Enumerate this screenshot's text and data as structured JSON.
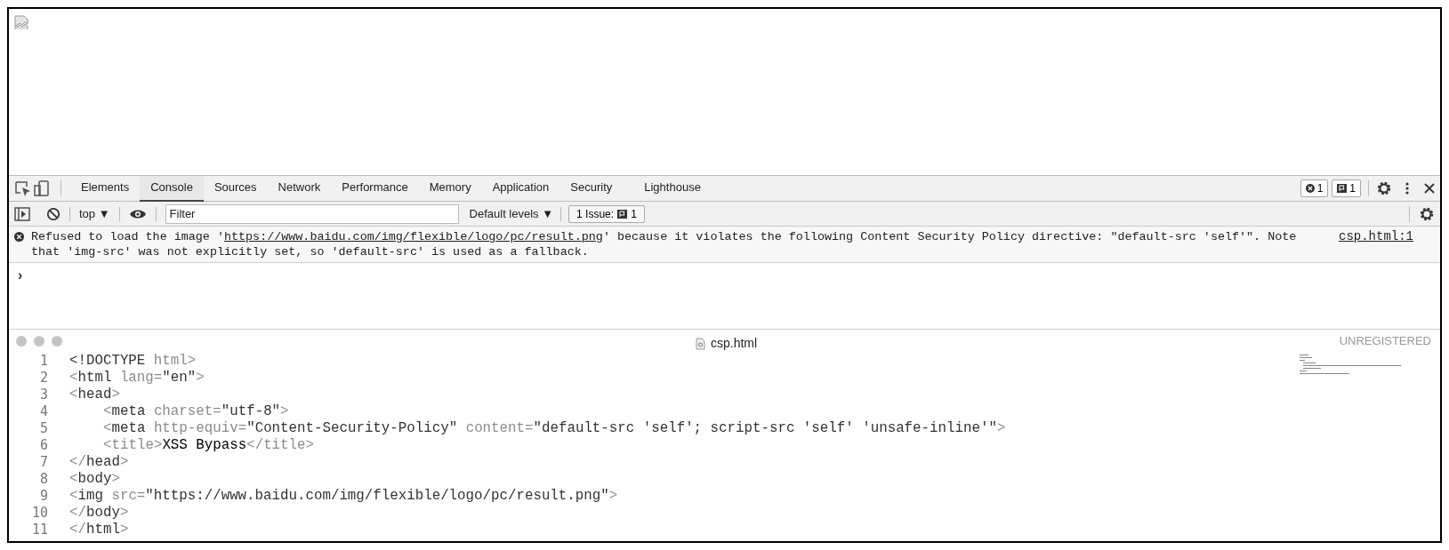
{
  "page": {
    "broken_image": true
  },
  "devtools": {
    "tabs": [
      {
        "label": "Elements",
        "selected": false
      },
      {
        "label": "Console",
        "selected": true
      },
      {
        "label": "Sources",
        "selected": false
      },
      {
        "label": "Network",
        "selected": false
      },
      {
        "label": "Performance",
        "selected": false
      },
      {
        "label": "Memory",
        "selected": false
      },
      {
        "label": "Application",
        "selected": false
      },
      {
        "label": "Security",
        "selected": false
      },
      {
        "label": "Lighthouse",
        "selected": false
      }
    ],
    "error_count": "1",
    "issue_count": "1",
    "context": "top ▼",
    "filter": {
      "placeholder": "Filter"
    },
    "levels": "Default levels ▼",
    "issues": {
      "label": "1 Issue:",
      "count": "1"
    },
    "message": {
      "before": "Refused to load the image '",
      "url": "https://www.baidu.com/img/flexible/logo/pc/result.png",
      "after_line1": "' because it violates the following Content Security Policy directive: \"default-src 'self'\". Note",
      "line2": "that 'img-src' was not explicitly set, so 'default-src' is used as a fallback.",
      "source": "csp.html:1"
    },
    "prompt": "›"
  },
  "editor": {
    "file": "csp.html",
    "badge": "UNREGISTERED",
    "lines": [
      {
        "number": "1",
        "tokens": [
          {
            "kind": "tag",
            "text": "<!DOCTYPE"
          },
          {
            "kind": "attr",
            "text": " html"
          },
          {
            "kind": "punct",
            "text": ">"
          }
        ]
      },
      {
        "number": "2",
        "tokens": [
          {
            "kind": "punct",
            "text": "<"
          },
          {
            "kind": "tag",
            "text": "html"
          },
          {
            "kind": "attr",
            "text": " lang"
          },
          {
            "kind": "punct",
            "text": "="
          },
          {
            "kind": "value",
            "text": "\"en\""
          },
          {
            "kind": "punct",
            "text": ">"
          }
        ]
      },
      {
        "number": "3",
        "tokens": [
          {
            "kind": "punct",
            "text": "<"
          },
          {
            "kind": "tag",
            "text": "head"
          },
          {
            "kind": "punct",
            "text": ">"
          }
        ],
        "children": [
          {
            "number": "4",
            "tokens": [
              {
                "kind": "punct",
                "text": "<"
              },
              {
                "kind": "tag",
                "text": "meta"
              },
              {
                "kind": "attr",
                "text": " charset"
              },
              {
                "kind": "punct",
                "text": "="
              },
              {
                "kind": "value",
                "text": "\"utf-8\""
              },
              {
                "kind": "punct",
                "text": ">"
              }
            ]
          },
          {
            "number": "5",
            "tokens": [
              {
                "kind": "punct",
                "text": "<"
              },
              {
                "kind": "tag",
                "text": "meta"
              },
              {
                "kind": "attr",
                "text": " http-equiv"
              },
              {
                "kind": "punct",
                "text": "="
              },
              {
                "kind": "value",
                "text": "\"Content-Security-Policy\""
              },
              {
                "kind": "attr",
                "text": " content"
              },
              {
                "kind": "punct",
                "text": "="
              },
              {
                "kind": "value",
                "text": "\"default-src 'self'; script-src 'self' 'unsafe-inline'\""
              },
              {
                "kind": "punct",
                "text": ">"
              }
            ]
          },
          {
            "number": "6",
            "tokens": [
              {
                "kind": "punct",
                "text": "<"
              },
              {
                "kind": "attr",
                "text": "title"
              },
              {
                "kind": "punct",
                "text": ">"
              },
              {
                "kind": "text",
                "text": "XSS Bypass"
              },
              {
                "kind": "punct",
                "text": "</"
              },
              {
                "kind": "attr",
                "text": "title"
              },
              {
                "kind": "punct",
                "text": ">"
              }
            ]
          }
        ]
      },
      {
        "number": "7",
        "tokens": [
          {
            "kind": "punct",
            "text": "</"
          },
          {
            "kind": "tag",
            "text": "head"
          },
          {
            "kind": "punct",
            "text": ">"
          }
        ]
      },
      {
        "number": "8",
        "tokens": [
          {
            "kind": "punct",
            "text": "<"
          },
          {
            "kind": "tag",
            "text": "body"
          },
          {
            "kind": "punct",
            "text": ">"
          }
        ]
      },
      {
        "number": "9",
        "tokens": [
          {
            "kind": "punct",
            "text": "<"
          },
          {
            "kind": "tag",
            "text": "img"
          },
          {
            "kind": "attr",
            "text": " src"
          },
          {
            "kind": "punct",
            "text": "="
          },
          {
            "kind": "value",
            "text": "\"https://www.baidu.com/img/flexible/logo/pc/result.png\""
          },
          {
            "kind": "punct",
            "text": ">"
          }
        ]
      },
      {
        "number": "10",
        "tokens": [
          {
            "kind": "punct",
            "text": "</"
          },
          {
            "kind": "tag",
            "text": "body"
          },
          {
            "kind": "punct",
            "text": ">"
          }
        ]
      },
      {
        "number": "11",
        "tokens": [
          {
            "kind": "punct",
            "text": "</"
          },
          {
            "kind": "tag",
            "text": "html"
          },
          {
            "kind": "punct",
            "text": ">"
          }
        ]
      }
    ]
  }
}
